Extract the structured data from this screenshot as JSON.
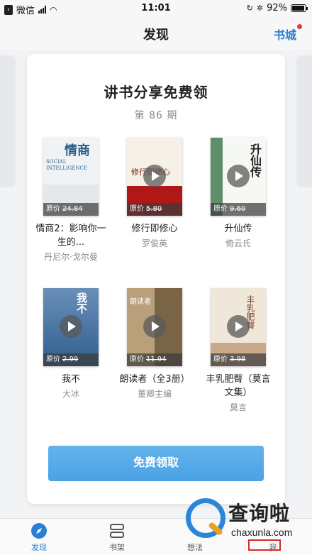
{
  "status_bar": {
    "back_app": "微信",
    "time": "11:01",
    "battery": "92%",
    "battery_level": 0.92
  },
  "header": {
    "title": "发现",
    "right_link": "书城"
  },
  "card": {
    "title": "讲书分享免费领",
    "issue": "第 86 期",
    "price_prefix": "原价",
    "books": [
      {
        "title": "情商2：影响你一生的...",
        "author": "丹尼尔·戈尔曼",
        "price": "24.84",
        "cover_text": "情商",
        "cover_sub": "SOCIAL INTELLIGENCE",
        "cover_color": "#eef1f3",
        "show_play": false
      },
      {
        "title": "修行即修心",
        "author": "罗俊英",
        "price": "5.80",
        "cover_text": "修行即修心",
        "cover_sub": "",
        "cover_color": "#f5f0e6",
        "show_play": true
      },
      {
        "title": "升仙传",
        "author": "倚云氏",
        "price": "9.60",
        "cover_text": "升仙传",
        "cover_sub": "",
        "cover_color": "#6f9a78",
        "show_play": true
      },
      {
        "title": "我不",
        "author": "大冰",
        "price": "2.99",
        "cover_text": "我不",
        "cover_sub": "",
        "cover_color": "#2a6ea8",
        "show_play": true
      },
      {
        "title": "朗读者（全3册）",
        "author": "董卿主编",
        "price": "11.94",
        "cover_text": "朗读者",
        "cover_sub": "",
        "cover_color": "#a58e6e",
        "show_play": true
      },
      {
        "title": "丰乳肥臀（莫言文集）",
        "author": "莫言",
        "price": "3.98",
        "cover_text": "丰乳肥臀",
        "cover_sub": "",
        "cover_color": "#ede6d8",
        "show_play": true
      }
    ],
    "button": "免费领取"
  },
  "tabs": [
    {
      "label": "发现",
      "icon": "compass-icon",
      "active": true
    },
    {
      "label": "书架",
      "icon": "bookshelf-icon",
      "active": false
    },
    {
      "label": "想法",
      "icon": "idea-icon",
      "active": false
    },
    {
      "label": "我",
      "icon": "profile-icon",
      "active": false
    }
  ],
  "watermark": {
    "name": "查询啦",
    "site": "chaxunla.com"
  },
  "colors": {
    "accent": "#2a7fd4",
    "button": "#55a9e8",
    "badge": "#e53935"
  }
}
